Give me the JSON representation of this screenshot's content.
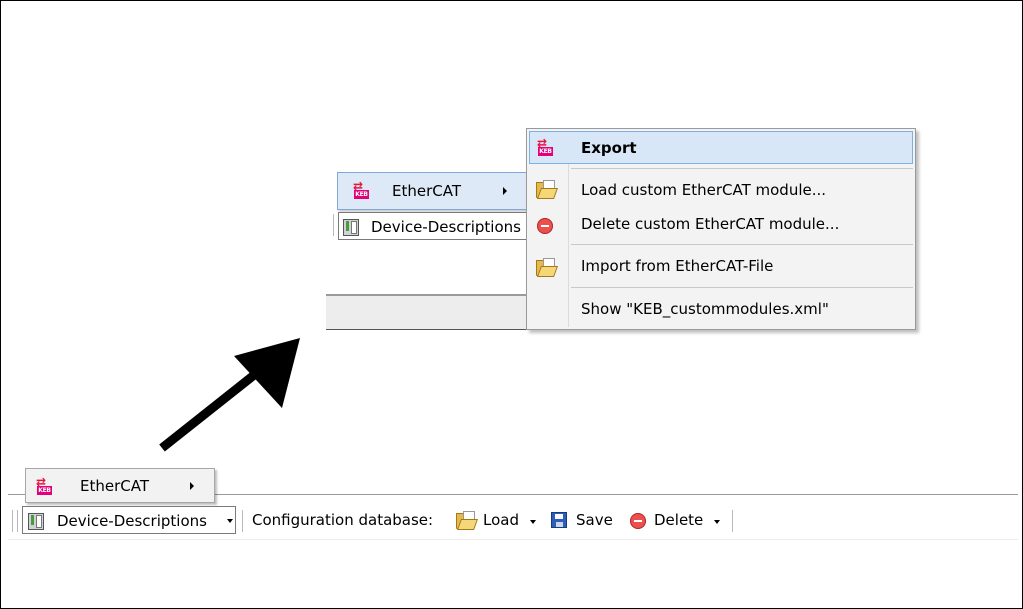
{
  "ethercat_label": "EtherCAT",
  "device_descriptions_label": "Device-Descriptions",
  "configuration_database_label": "Configuration database:",
  "load_label": "Load",
  "save_label": "Save",
  "delete_label": "Delete",
  "submenu": {
    "export": "Export",
    "load_custom": "Load custom EtherCAT module...",
    "delete_custom": "Delete custom EtherCAT module...",
    "import": "Import from EtherCAT-File",
    "show": "Show \"KEB_custommodules.xml\""
  },
  "icons": {
    "keb": "keb-logo-icon",
    "folder": "folder-open-icon",
    "delete": "delete-icon",
    "save": "save-icon",
    "device": "device-icon",
    "arrow": "arrow-icon"
  },
  "colors": {
    "highlight": "#d7e7f8",
    "keb_brand": "#e4007a"
  }
}
